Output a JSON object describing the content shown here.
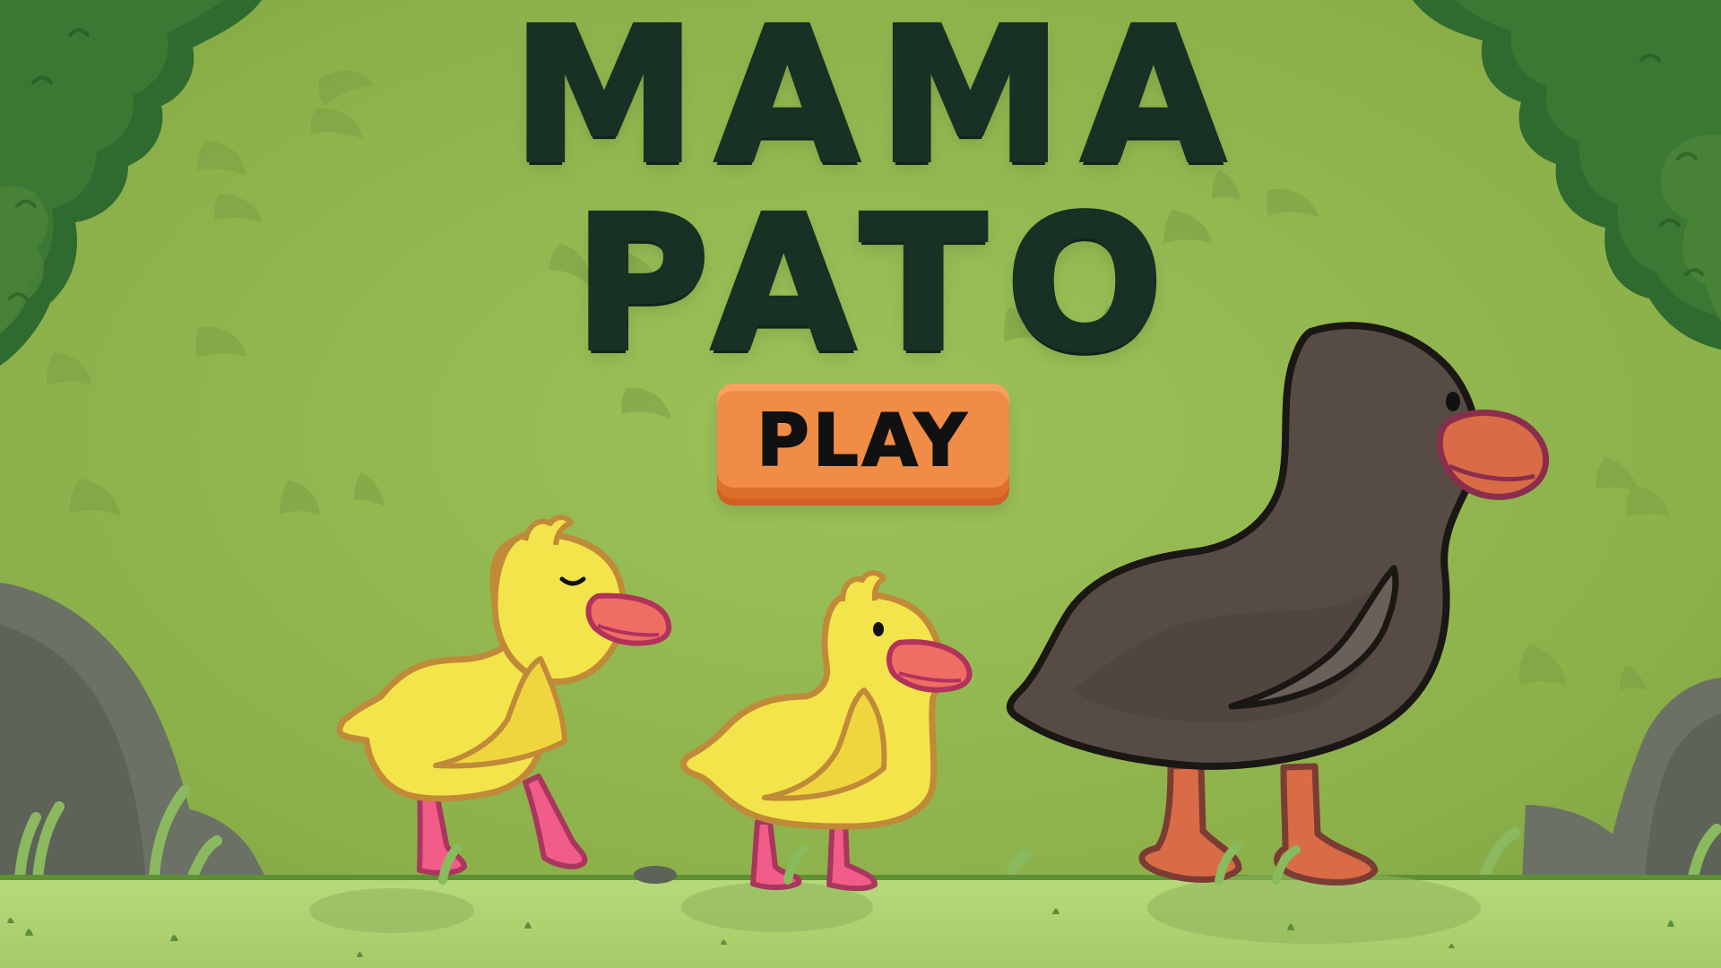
{
  "game": {
    "title_line_1": "MAMA",
    "title_line_2": "PATO"
  },
  "menu": {
    "play_label": "PLAY"
  },
  "colors": {
    "background": "#8fb44a",
    "title_text": "#173124",
    "play_button": "#f08c46",
    "ground": "#a9cf6a",
    "duckling": "#f4df42",
    "mama_duck": "#5b4f47",
    "beak": "#f06d63"
  }
}
